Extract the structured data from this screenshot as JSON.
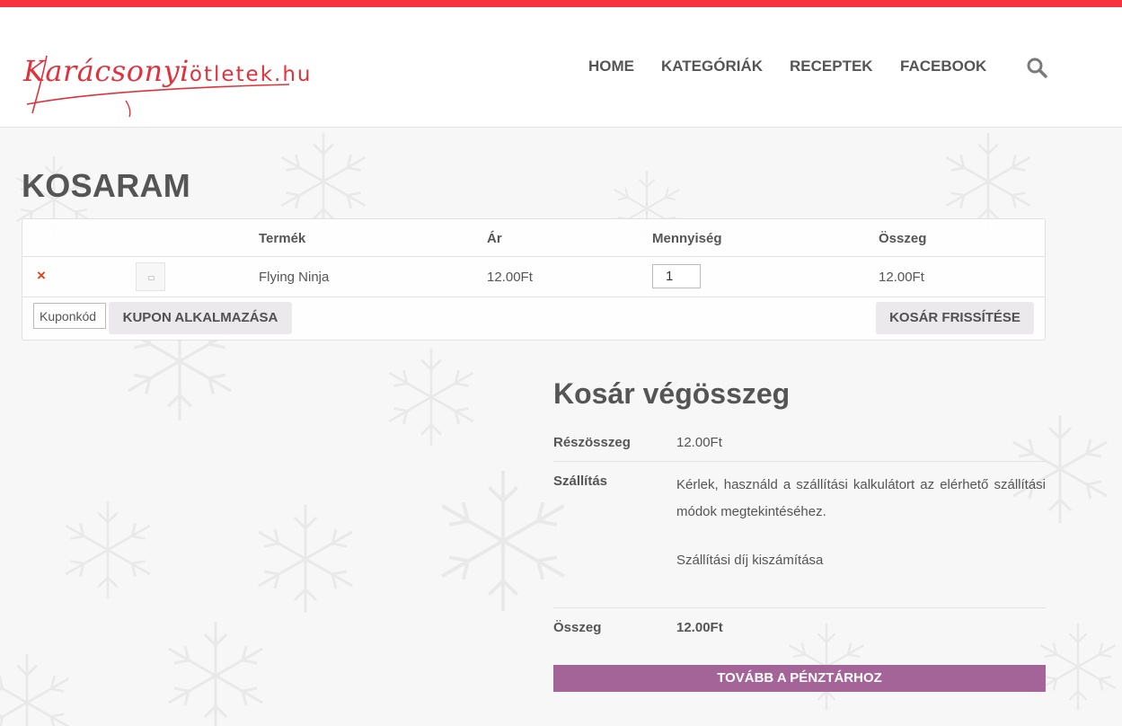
{
  "brand": {
    "logo_text_main": "Karácsonyi",
    "logo_text_rest": "ötletek.hu",
    "accent_color": "#f7333f",
    "checkout_color": "#a46497"
  },
  "nav": {
    "items": [
      "HOME",
      "KATEGÓRIÁK",
      "RECEPTEK",
      "FACEBOOK"
    ],
    "search_icon": "search-icon"
  },
  "page": {
    "title": "KOSARAM"
  },
  "cart": {
    "headers": {
      "product": "Termék",
      "price": "Ár",
      "quantity": "Mennyiség",
      "subtotal": "Összeg"
    },
    "items": [
      {
        "remove_symbol": "×",
        "name": "Flying Ninja",
        "price": "12.00Ft",
        "quantity": "1",
        "subtotal": "12.00Ft"
      }
    ],
    "coupon_placeholder": "Kuponkód",
    "apply_coupon_label": "KUPON ALKALMAZÁSA",
    "update_cart_label": "KOSÁR FRISSÍTÉSE"
  },
  "totals": {
    "title": "Kosár végösszeg",
    "subtotal_label": "Részösszeg",
    "subtotal_value": "12.00Ft",
    "shipping_label": "Szállítás",
    "shipping_text": "Kérlek, használd a szállítási kalkulátort az elérhető szállítási módok megtekintéséhez.",
    "shipping_calc_link": "Szállítási díj kiszámítása",
    "total_label": "Összeg",
    "total_value": "12.00Ft",
    "checkout_label": "TOVÁBB A PÉNZTÁRHOZ"
  }
}
